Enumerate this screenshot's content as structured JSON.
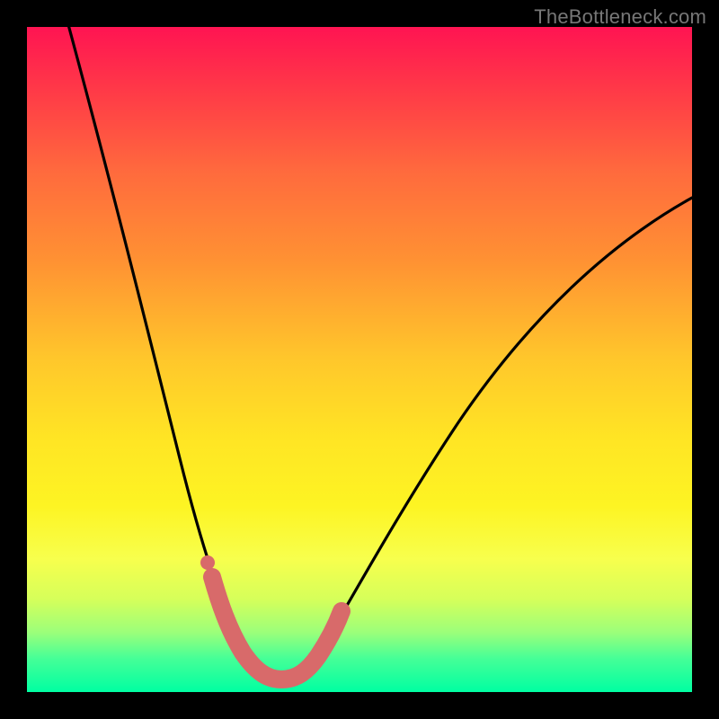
{
  "watermark": "TheBottleneck.com",
  "chart_data": {
    "type": "line",
    "title": "",
    "xlabel": "",
    "ylabel": "",
    "xlim": [
      0,
      100
    ],
    "ylim": [
      0,
      100
    ],
    "legend": false,
    "grid": false,
    "background_gradient": {
      "stops": [
        {
          "pos": 0,
          "color": "#ff1452"
        },
        {
          "pos": 10,
          "color": "#ff3b47"
        },
        {
          "pos": 22,
          "color": "#ff6b3d"
        },
        {
          "pos": 35,
          "color": "#ff9133"
        },
        {
          "pos": 50,
          "color": "#ffc72b"
        },
        {
          "pos": 62,
          "color": "#ffe524"
        },
        {
          "pos": 72,
          "color": "#fdf423"
        },
        {
          "pos": 80,
          "color": "#f7ff4d"
        },
        {
          "pos": 86,
          "color": "#d6ff5a"
        },
        {
          "pos": 91,
          "color": "#9cff7a"
        },
        {
          "pos": 95,
          "color": "#45ff97"
        },
        {
          "pos": 100,
          "color": "#00ffa2"
        }
      ]
    },
    "series": [
      {
        "name": "bottleneck-curve",
        "color": "#000000",
        "x": [
          6,
          10,
          14,
          18,
          22,
          26,
          30,
          33,
          36,
          40,
          44,
          48,
          55,
          62,
          70,
          78,
          86,
          94,
          100
        ],
        "values": [
          100,
          80,
          62,
          46,
          33,
          22,
          13,
          7,
          3,
          3,
          6,
          12,
          22,
          33,
          44,
          53,
          60,
          66,
          70
        ]
      }
    ],
    "highlight_segment": {
      "name": "near-optimal-band",
      "color": "#d86a6a",
      "x": [
        28,
        30,
        32,
        34,
        36,
        38,
        40,
        42,
        44
      ],
      "values": [
        17,
        11,
        6,
        3,
        2,
        2,
        3,
        6,
        10
      ]
    }
  }
}
